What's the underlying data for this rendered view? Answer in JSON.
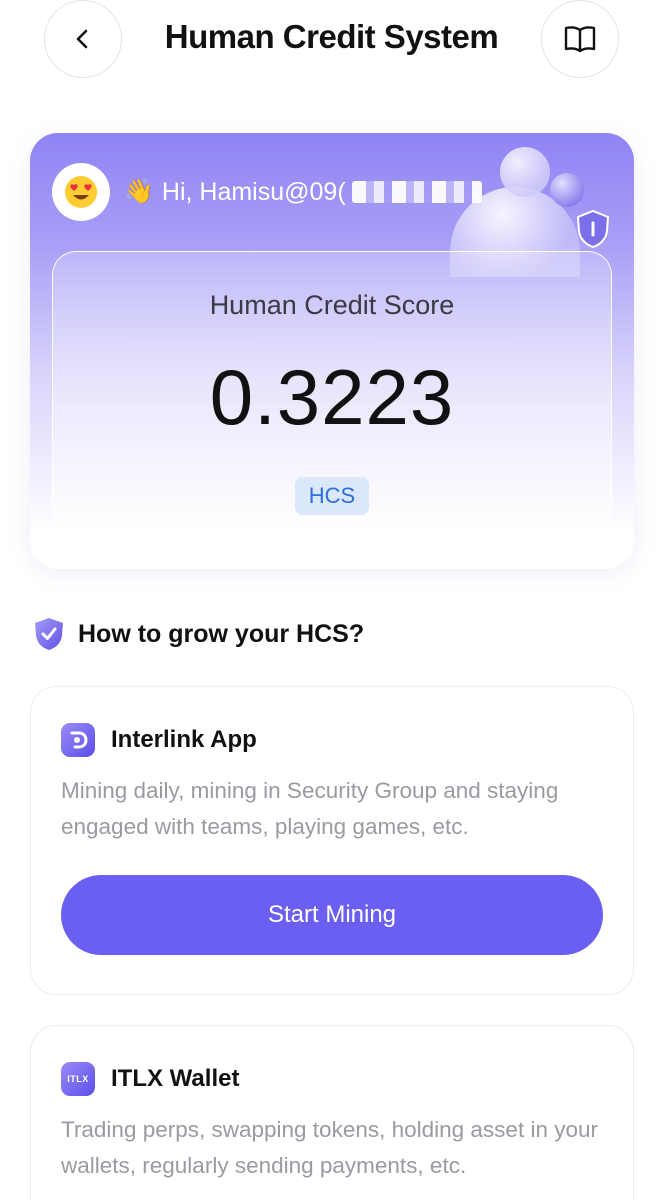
{
  "header": {
    "title": "Human Credit System",
    "back_icon": "chevron-left-icon",
    "guide_icon": "book-icon"
  },
  "score_card": {
    "greeting": "Hi, Hamisu@09(",
    "avatar_icon": "heart-eyes-emoji-icon",
    "wave_icon": "waving-hand-icon",
    "score_label": "Human Credit Score",
    "score_value": "0.3223",
    "unit": "HCS"
  },
  "section": {
    "title": "How to grow your HCS?",
    "icon": "shield-check-icon"
  },
  "methods": [
    {
      "title": "Interlink App",
      "description": "Mining daily, mining in Security Group and staying engaged with teams, playing games, etc.",
      "button_label": "Start Mining",
      "icon": "interlink-logo-icon"
    },
    {
      "title": "ITLX Wallet",
      "description": "Trading perps, swapping tokens, holding asset in your wallets, regularly sending payments, etc.",
      "icon": "itlx-logo-icon",
      "icon_text": "ITLX"
    }
  ],
  "colors": {
    "accent": "#6a5ff0",
    "badge_bg": "#dbe7fb",
    "badge_text": "#2e6fd8"
  }
}
